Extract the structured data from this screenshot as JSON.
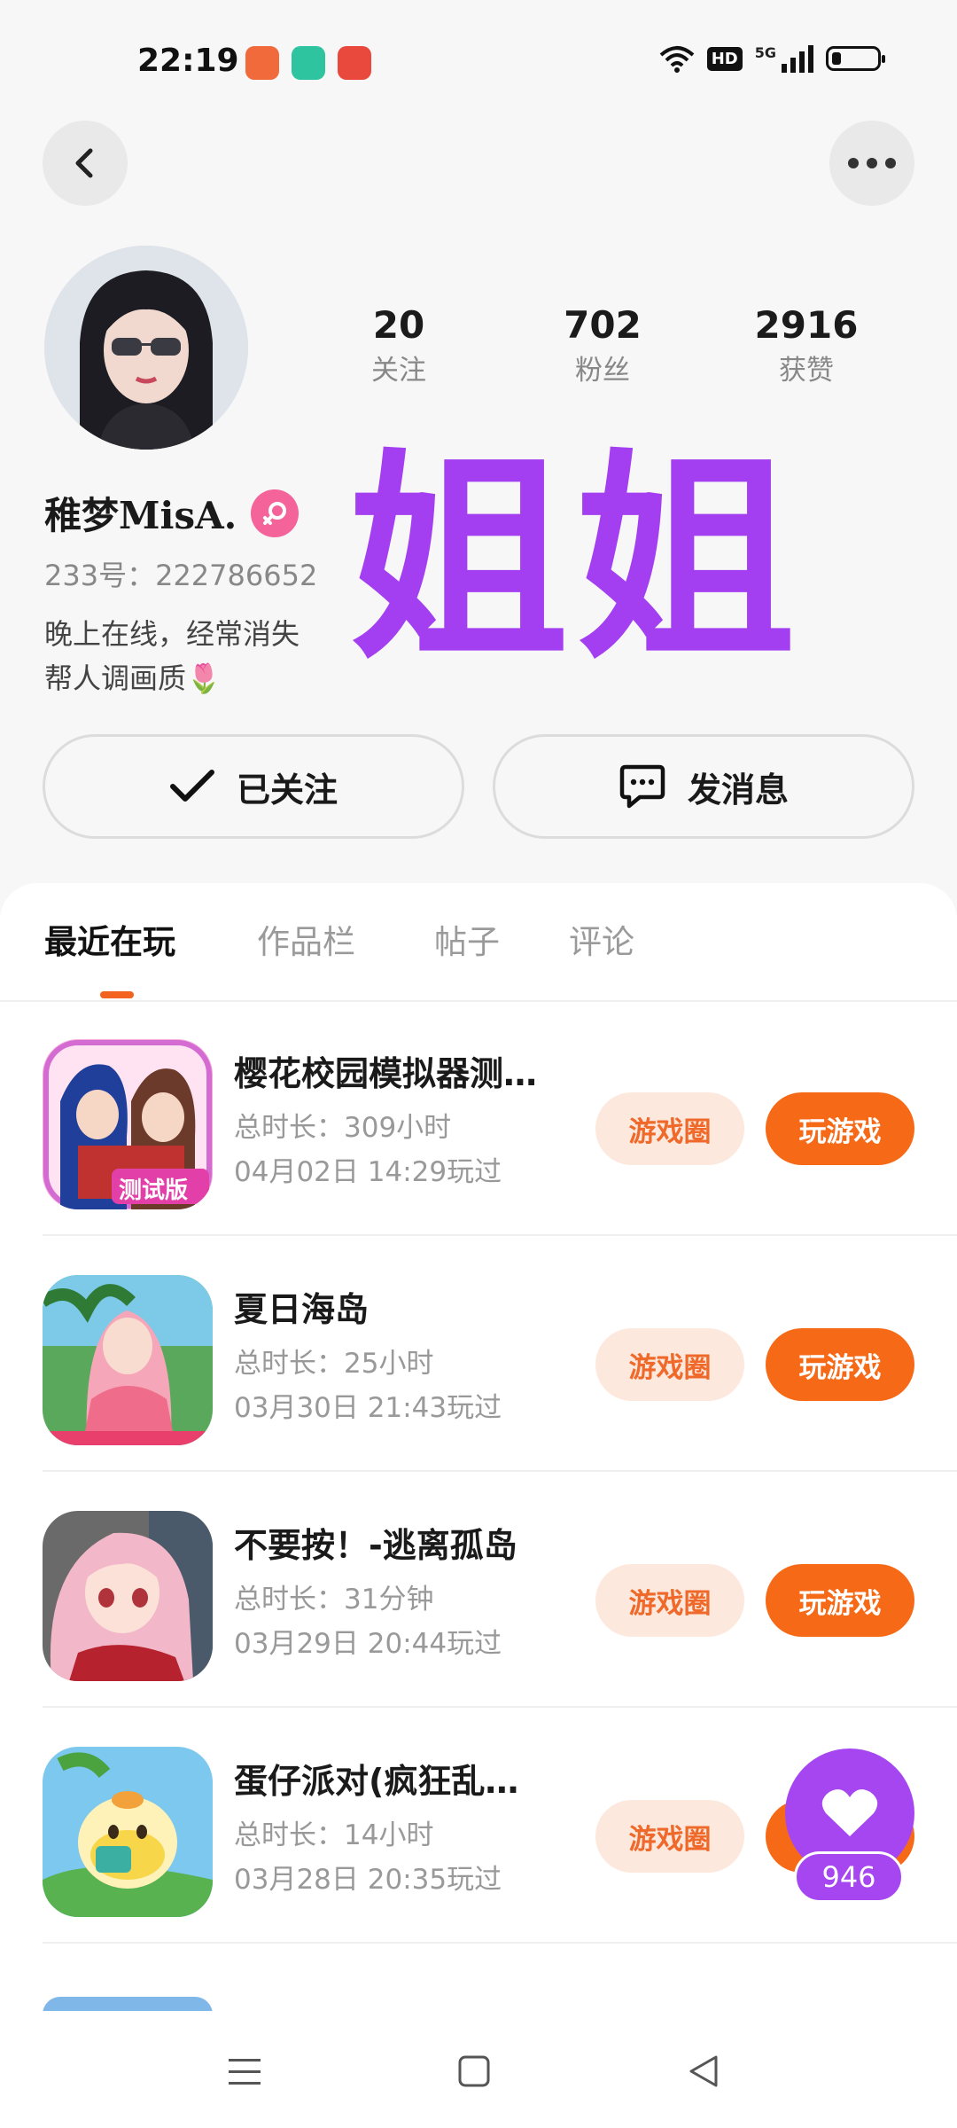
{
  "status_bar": {
    "time": "22:19",
    "network": "5G",
    "hd": "HD",
    "notification_icons": [
      "reader-app-icon",
      "camera-app-icon",
      "music-app-icon"
    ]
  },
  "header": {
    "back_icon": "chevron-left-icon",
    "more_icon": "more-dots-icon"
  },
  "profile": {
    "stats": [
      {
        "value": "20",
        "label": "关注"
      },
      {
        "value": "702",
        "label": "粉丝"
      },
      {
        "value": "2916",
        "label": "获赞"
      }
    ],
    "nickname": "稚梦MisA.",
    "gender": "female",
    "uid": "233号：222786652",
    "bio_line1": "晚上在线，经常消失",
    "bio_line2": "帮人调画质🌷",
    "overlay_text": "姐姐"
  },
  "actions": {
    "follow_label": "已关注",
    "message_label": "发消息"
  },
  "tabs": [
    {
      "label": "最近在玩",
      "active": true
    },
    {
      "label": "作品栏",
      "active": false
    },
    {
      "label": "帖子",
      "active": false
    },
    {
      "label": "评论",
      "active": false
    }
  ],
  "games": [
    {
      "name": "樱花校园模拟器测…",
      "duration": "总时长：309小时",
      "last_played": "04月02日 14:29玩过",
      "icon_text": "测试版",
      "circle_label": "游戏圈",
      "play_label": "玩游戏"
    },
    {
      "name": "夏日海岛",
      "duration": "总时长：25小时",
      "last_played": "03月30日 21:43玩过",
      "circle_label": "游戏圈",
      "play_label": "玩游戏"
    },
    {
      "name": "不要按！-逃离孤岛",
      "duration": "总时长：31分钟",
      "last_played": "03月29日 20:44玩过",
      "circle_label": "游戏圈",
      "play_label": "玩游戏"
    },
    {
      "name": "蛋仔派对(疯狂乱…",
      "duration": "总时长：14小时",
      "last_played": "03月28日 20:35玩过",
      "circle_label": "游戏圈",
      "play_label": "玩游戏"
    }
  ],
  "float_like": {
    "count": "946"
  },
  "colors": {
    "accent": "#f66a17",
    "accent_light": "#fde8de",
    "overlay_purple": "#a33ff0",
    "like_purple": "#a646f0"
  }
}
